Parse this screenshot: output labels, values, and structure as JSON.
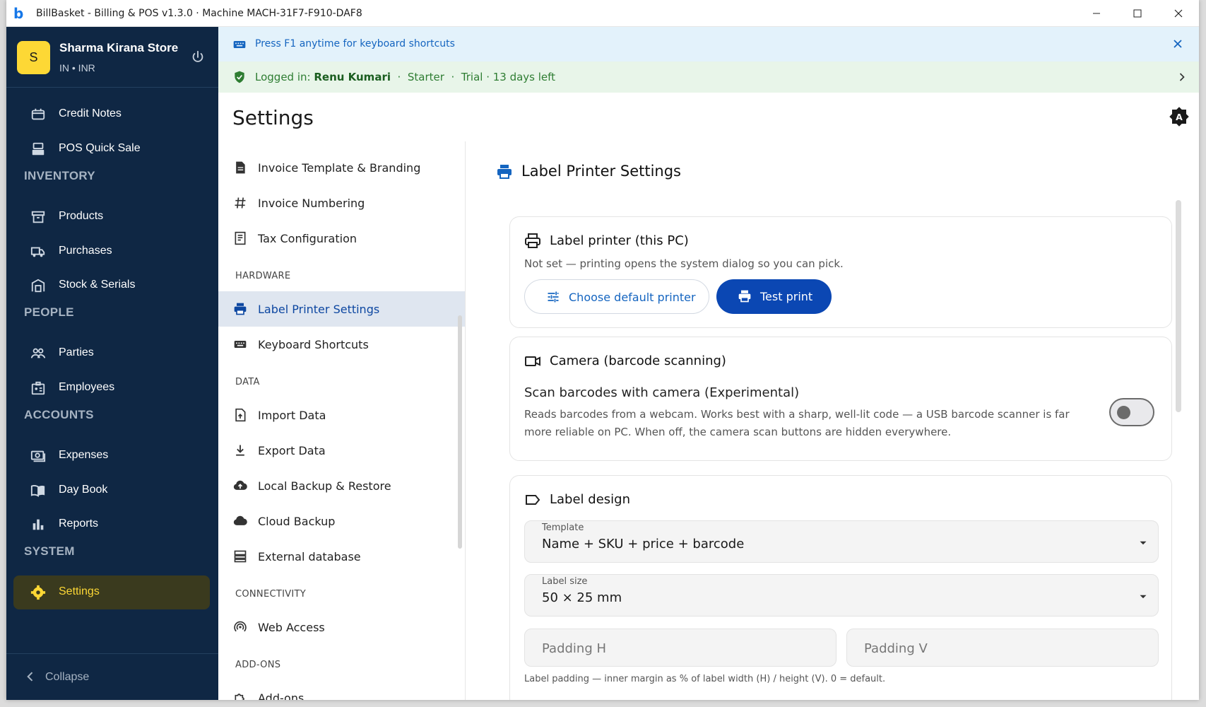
{
  "window": {
    "title": "BillBasket - Billing & POS  v1.3.0  ·  Machine MACH-31F7-F910-DAF8"
  },
  "sidebar": {
    "store_initial": "S",
    "store_name": "Sharma Kirana Store",
    "store_sub": "IN • INR",
    "items_top": [
      {
        "label": "Credit Notes",
        "icon": "credit-note-icon"
      },
      {
        "label": "POS Quick Sale",
        "icon": "register-icon"
      }
    ],
    "sections": {
      "inventory": "INVENTORY",
      "people": "PEOPLE",
      "accounts": "ACCOUNTS",
      "system": "SYSTEM"
    },
    "inventory_items": [
      {
        "label": "Products",
        "icon": "archive-icon"
      },
      {
        "label": "Purchases",
        "icon": "truck-icon"
      },
      {
        "label": "Stock & Serials",
        "icon": "warehouse-icon"
      }
    ],
    "people_items": [
      {
        "label": "Parties",
        "icon": "group-icon"
      },
      {
        "label": "Employees",
        "icon": "badge-icon"
      }
    ],
    "accounts_items": [
      {
        "label": "Expenses",
        "icon": "money-icon"
      },
      {
        "label": "Day Book",
        "icon": "book-icon"
      },
      {
        "label": "Reports",
        "icon": "bar-chart-icon"
      }
    ],
    "system_items": [
      {
        "label": "Settings",
        "icon": "gear-icon",
        "active": true
      }
    ],
    "collapse_label": "Collapse",
    "active_color": "#fdd835",
    "bg_color": "#0f2744"
  },
  "banners": {
    "shortcuts": "Press F1 anytime for keyboard shortcuts",
    "login_prefix": "Logged in:",
    "login_user": "Renu Kumari",
    "login_sep1": "·",
    "login_plan": "Starter",
    "login_sep2": "·",
    "login_trial": "Trial · 13 days left"
  },
  "page": {
    "title": "Settings"
  },
  "settings_nav": {
    "items_general": [
      {
        "label": "Invoice Template & Branding",
        "icon": "document-icon"
      },
      {
        "label": "Invoice Numbering",
        "icon": "hash-icon"
      },
      {
        "label": "Tax Configuration",
        "icon": "receipt-icon"
      }
    ],
    "hardware_head": "HARDWARE",
    "hardware_items": [
      {
        "label": "Label Printer Settings",
        "icon": "printer-icon",
        "active": true
      },
      {
        "label": "Keyboard Shortcuts",
        "icon": "keyboard-icon"
      }
    ],
    "data_head": "DATA",
    "data_items": [
      {
        "label": "Import Data",
        "icon": "file-import-icon"
      },
      {
        "label": "Export Data",
        "icon": "download-icon"
      },
      {
        "label": "Local Backup & Restore",
        "icon": "cloud-upload-icon"
      },
      {
        "label": "Cloud Backup",
        "icon": "cloud-icon"
      },
      {
        "label": "External database",
        "icon": "storage-icon"
      }
    ],
    "connectivity_head": "CONNECTIVITY",
    "connectivity_items": [
      {
        "label": "Web Access",
        "icon": "broadcast-icon"
      }
    ],
    "addons_head": "ADD-ONS",
    "addons_items": [
      {
        "label": "Add-ons",
        "icon": "puzzle-icon"
      }
    ]
  },
  "content": {
    "title": "Label Printer Settings",
    "printer_card": {
      "title": "Label printer (this PC)",
      "desc": "Not set — printing opens the system dialog so you can pick.",
      "choose_label": "Choose default printer",
      "test_label": "Test print"
    },
    "camera_card": {
      "title": "Camera (barcode scanning)",
      "toggle_title": "Scan barcodes with camera (Experimental)",
      "toggle_desc_1": "Reads barcodes from a webcam. Works best with a sharp, well-lit code — a USB barcode scanner is far",
      "toggle_desc_2": "more reliable on PC. When off, the camera scan buttons are hidden everywhere.",
      "enabled": false
    },
    "label_card": {
      "title": "Label design",
      "template_label": "Template",
      "template_value": "Name + SKU + price + barcode",
      "size_label": "Label size",
      "size_value": "50 × 25 mm",
      "padding_h_placeholder": "Padding H",
      "padding_v_placeholder": "Padding V",
      "helper": "Label padding — inner margin as % of label width (H) / height (V). 0 = default."
    }
  },
  "colors": {
    "primary": "#0b47b3",
    "link": "#1565c0",
    "success": "#2e7d32"
  }
}
